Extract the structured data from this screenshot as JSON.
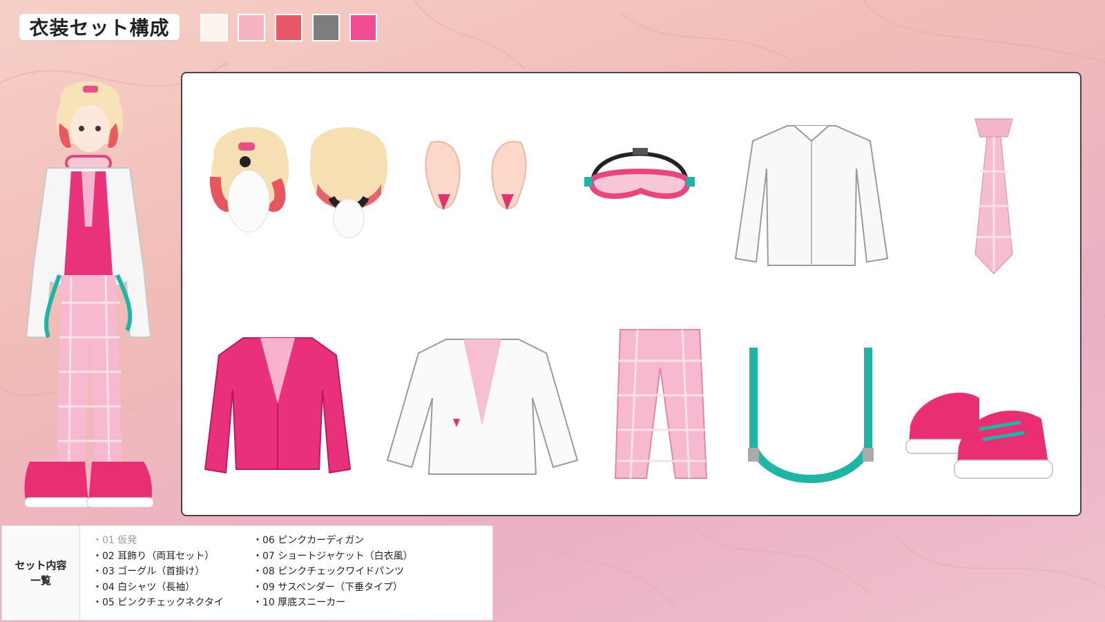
{
  "title": "衣装セット構成",
  "palette": [
    "#fbf3ec",
    "#f6b3c0",
    "#e85868",
    "#7d7d80",
    "#f04d93"
  ],
  "items": [
    {
      "name": "hair",
      "icon": "hair-icon"
    },
    {
      "name": "earrings",
      "icon": "ear-icon"
    },
    {
      "name": "goggles",
      "icon": "goggles-icon"
    },
    {
      "name": "white-shirt",
      "icon": "shirt-icon"
    },
    {
      "name": "pink-necktie",
      "icon": "tie-icon"
    },
    {
      "name": "pink-cardigan",
      "icon": "cardigan-icon"
    },
    {
      "name": "short-jacket",
      "icon": "jacket-icon"
    },
    {
      "name": "check-pants",
      "icon": "pants-icon"
    },
    {
      "name": "suspenders",
      "icon": "suspenders-icon"
    },
    {
      "name": "sneakers",
      "icon": "sneaker-icon"
    }
  ],
  "set_list": {
    "label_line1": "セット内容",
    "label_line2": "一覧",
    "col1": [
      "・01 仮発",
      "・02 耳飾り（両耳セット）",
      "・03 ゴーグル（首掛け）",
      "・04 白シャツ（長袖）",
      "・05 ピンクチェックネクタイ"
    ],
    "col2": [
      "・06 ピンクカーディガン",
      "・07 ショートジャケット（白衣風）",
      "・08 ピンクチェックワイドパンツ",
      "・09 サスペンダー（下垂タイプ）",
      "・10 厚底スニーカー"
    ]
  }
}
